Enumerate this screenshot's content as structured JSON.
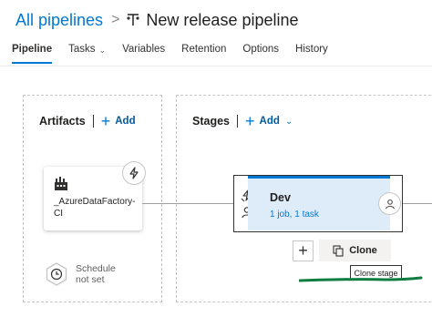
{
  "breadcrumb": {
    "root": "All pipelines",
    "separator": ">",
    "title": "New release pipeline"
  },
  "tabs": [
    {
      "label": "Pipeline",
      "active": true
    },
    {
      "label": "Tasks",
      "has_dropdown": true
    },
    {
      "label": "Variables"
    },
    {
      "label": "Retention"
    },
    {
      "label": "Options"
    },
    {
      "label": "History"
    }
  ],
  "artifacts": {
    "heading": "Artifacts",
    "add_label": "Add",
    "artifact_name": "_AzureDataFactory-CI",
    "schedule_text": "Schedule not set"
  },
  "stages": {
    "heading": "Stages",
    "add_label": "Add",
    "stage": {
      "name": "Dev",
      "detail": "1 job, 1 task"
    },
    "clone_label": "Clone",
    "tooltip": "Clone stage"
  },
  "colors": {
    "accent": "#0078d4",
    "stage_fill": "#deecf9",
    "annotation_mark": "#107c41"
  }
}
